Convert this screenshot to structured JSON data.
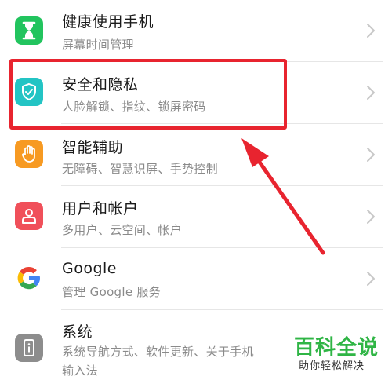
{
  "settings_list": {
    "items": [
      {
        "title": "健康使用手机",
        "subtitle": "屏幕时间管理",
        "icon": "hourglass-icon",
        "icon_color": "#22c45e"
      },
      {
        "title": "安全和隐私",
        "subtitle": "人脸解锁、指纹、锁屏密码",
        "icon": "shield-check-icon",
        "icon_color": "#23c4c4"
      },
      {
        "title": "智能辅助",
        "subtitle": "无障碍、智慧识屏、手势控制",
        "icon": "hand-icon",
        "icon_color": "#f79a22"
      },
      {
        "title": "用户和帐户",
        "subtitle": "多用户、云空间、帐户",
        "icon": "user-icon",
        "icon_color": "#f0505a"
      },
      {
        "title": "Google",
        "subtitle": "管理 Google 服务",
        "icon": "google-icon",
        "icon_color": "#4285f4"
      },
      {
        "title": "系统",
        "subtitle_line1": "系统导航方式、软件更新、关于手机",
        "subtitle_line2": "输入法",
        "icon": "info-phone-icon",
        "icon_color": "#8d8d8d"
      }
    ]
  },
  "annotation": {
    "highlight_color": "#e8242f",
    "highlighted_item": "安全和隐私"
  },
  "watermark": {
    "title": "百科全说",
    "subtitle": "助你轻松解决",
    "color": "#2fb545"
  }
}
